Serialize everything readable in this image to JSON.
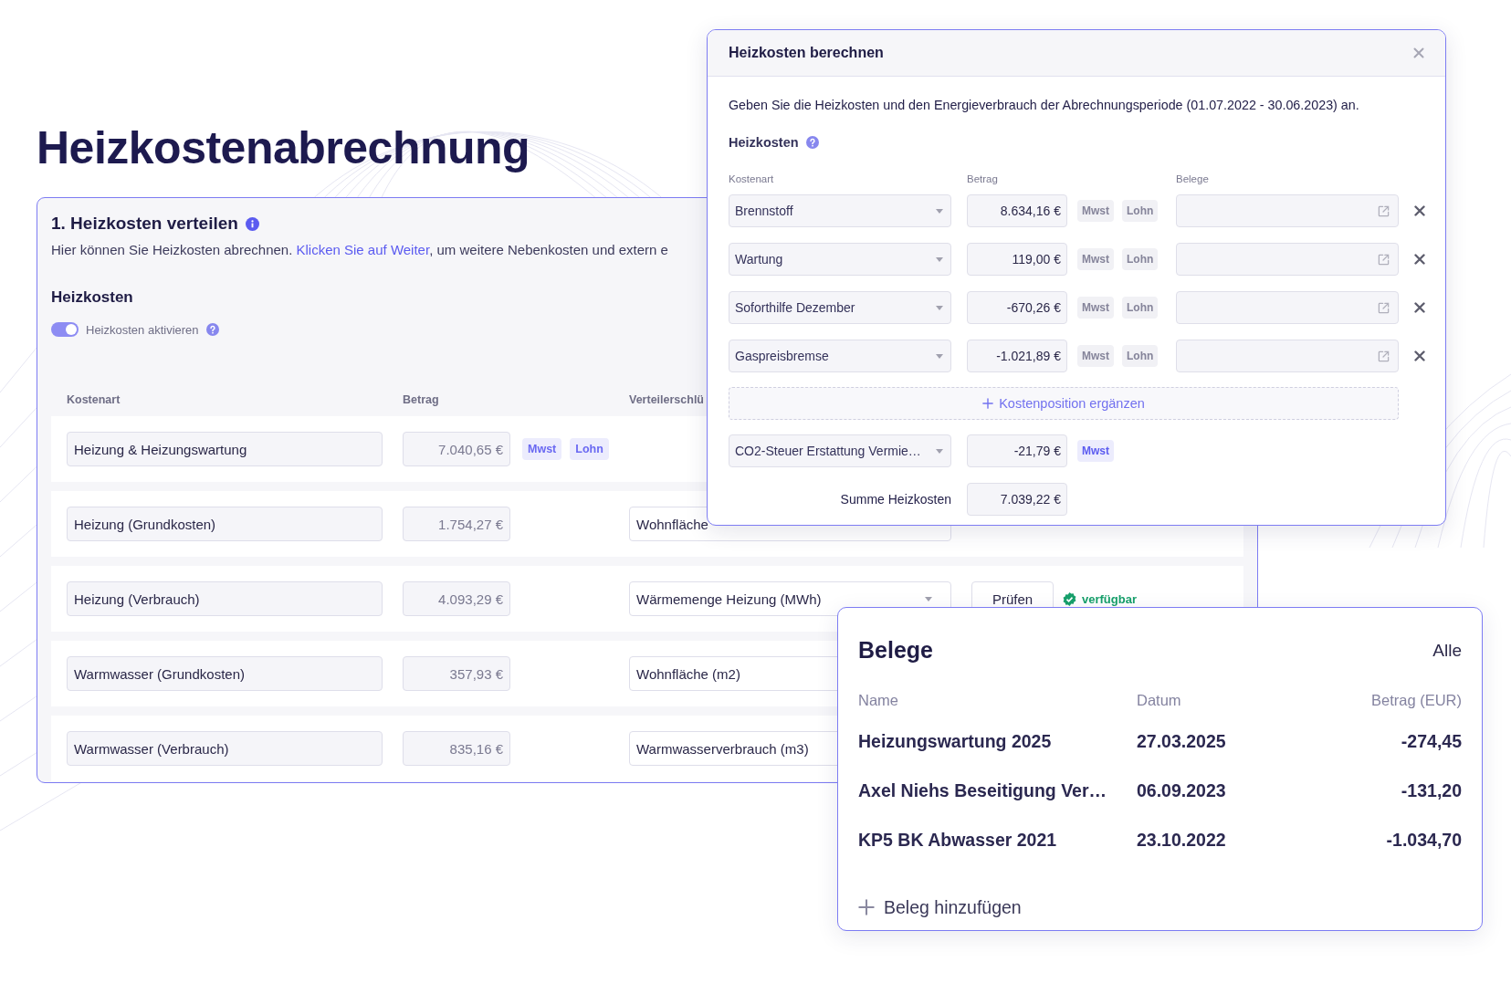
{
  "page_title": "Heizkostenabrechnung",
  "distribution": {
    "title": "1. Heizkosten verteilen",
    "description": {
      "before": "Hier können Sie Heizkosten abrechnen. ",
      "link": "Klicken Sie auf Weiter",
      "after": ", um weitere Nebenkosten und extern e"
    },
    "section_title": "Heizkosten",
    "toggle": {
      "label": "Heizkosten aktivieren",
      "on": true
    },
    "columns": [
      "Kostenart",
      "Betrag",
      "Verteilerschlü"
    ],
    "rows": [
      {
        "cost_type": "Heizung & Heizungswartung",
        "amount": "7.040,65 €",
        "tags": [
          {
            "label": "Mwst",
            "active": true
          },
          {
            "label": "Lohn",
            "active": true
          }
        ]
      },
      {
        "cost_type": "Heizung (Grundkosten)",
        "amount": "1.754,27 €",
        "tags": [],
        "distribution_key": {
          "kind": "field",
          "value": "Wohnfläche"
        }
      },
      {
        "cost_type": "Heizung (Verbrauch)",
        "amount": "4.093,29 €",
        "tags": [],
        "distribution_key": {
          "kind": "dropdown",
          "value": "Wärmemenge Heizung (MWh)"
        },
        "check": {
          "button": "Prüfen",
          "status": "verfügbar"
        }
      },
      {
        "cost_type": "Warmwasser (Grundkosten)",
        "amount": "357,93 €",
        "tags": [],
        "distribution_key": {
          "kind": "field",
          "value": "Wohnfläche (m2)"
        }
      },
      {
        "cost_type": "Warmwasser (Verbrauch)",
        "amount": "835,16 €",
        "tags": [],
        "distribution_key": {
          "kind": "field",
          "value": "Warmwasserverbrauch (m3)"
        }
      }
    ]
  },
  "dialog": {
    "title": "Heizkosten berechnen",
    "description": "Geben Sie die Heizkosten und den Energieverbrauch der Abrechnungsperiode (01.07.2022 - 30.06.2023) an.",
    "section_title": "Heizkosten",
    "columns": [
      "Kostenart",
      "Betrag",
      "Belege"
    ],
    "positions": [
      {
        "cost_type": "Brennstoff",
        "amount": "8.634,16 €",
        "tags": [
          {
            "label": "Mwst",
            "active": false
          },
          {
            "label": "Lohn",
            "active": false
          }
        ]
      },
      {
        "cost_type": "Wartung",
        "amount": "119,00 €",
        "tags": [
          {
            "label": "Mwst",
            "active": false
          },
          {
            "label": "Lohn",
            "active": false
          }
        ]
      },
      {
        "cost_type": "Soforthilfe Dezember",
        "amount": "-670,26 €",
        "tags": [
          {
            "label": "Mwst",
            "active": false
          },
          {
            "label": "Lohn",
            "active": false
          }
        ]
      },
      {
        "cost_type": "Gaspreisbremse",
        "amount": "-1.021,89 €",
        "tags": [
          {
            "label": "Mwst",
            "active": false
          },
          {
            "label": "Lohn",
            "active": false
          }
        ]
      }
    ],
    "add_label": "Kostenposition ergänzen",
    "tax_row": {
      "cost_type": "CO2-Steuer Erstattung Vermie…",
      "amount": "-21,79 €",
      "tags": [
        {
          "label": "Mwst",
          "active": true
        }
      ]
    },
    "sum": {
      "label": "Summe Heizkosten",
      "value": "7.039,22 €"
    }
  },
  "receipts": {
    "title": "Belege",
    "all_link": "Alle",
    "columns": [
      "Name",
      "Datum",
      "Betrag (EUR)"
    ],
    "rows": [
      {
        "name": "Heizungswartung 2025",
        "date": "27.03.2025",
        "amount": "-274,45"
      },
      {
        "name": "Axel Niehs Beseitigung Ver…",
        "date": "06.09.2023",
        "amount": "-131,20"
      },
      {
        "name": "KP5 BK Abwasser 2021",
        "date": "23.10.2022",
        "amount": "-1.034,70"
      }
    ],
    "add_label": "Beleg hinzufügen"
  }
}
